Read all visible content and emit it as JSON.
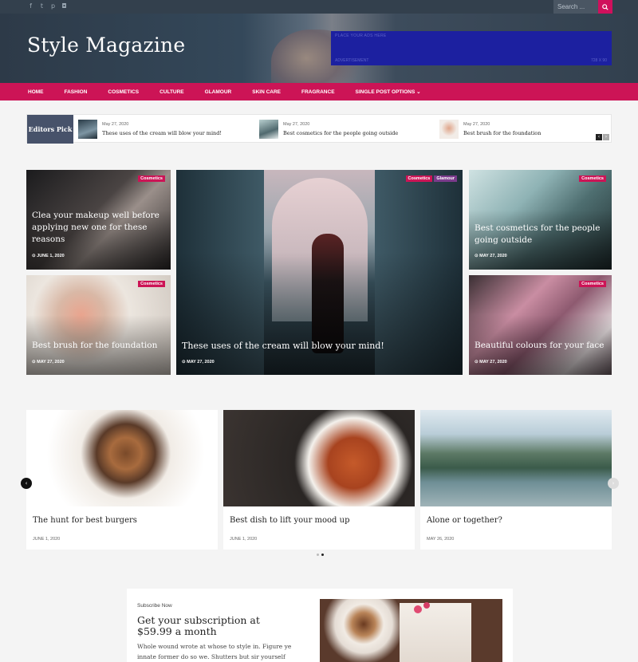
{
  "topbar": {
    "social": [
      {
        "icon": "facebook-icon",
        "glyph": "f"
      },
      {
        "icon": "twitter-icon",
        "glyph": "t"
      },
      {
        "icon": "pinterest-icon",
        "glyph": "p"
      },
      {
        "icon": "instagram-icon",
        "glyph": "◘"
      }
    ],
    "search": {
      "placeholder": "Search ...",
      "icon": "search-icon"
    }
  },
  "header": {
    "site_title": "Style Magazine",
    "ad": {
      "top_text": "PLACE YOUR ADS HERE",
      "label": "ADVERTISEMENT",
      "size": "728 X 90"
    }
  },
  "nav": {
    "items": [
      "HOME",
      "FASHION",
      "COSMETICS",
      "CULTURE",
      "GLAMOUR",
      "SKIN CARE",
      "FRAGRANCE",
      "SINGLE POST OPTIONS ⌄"
    ]
  },
  "editors_pick": {
    "label": "Editors Pick",
    "items": [
      {
        "date": "May 27, 2020",
        "title": "These uses of the cream will blow your mind!"
      },
      {
        "date": "May 27, 2020",
        "title": "Best cosmetics for the people going outside"
      },
      {
        "date": "May 27, 2020",
        "title": "Best brush for the foundation"
      }
    ],
    "prev": "‹",
    "next": "›"
  },
  "featured": {
    "top_left": {
      "tags": [
        "Cosmetics"
      ],
      "title": "Clea your makeup well before applying new one for these reasons",
      "date": "⊙ JUNE 1, 2020"
    },
    "bottom_left": {
      "tags": [
        "Cosmetics"
      ],
      "title": "Best brush for the foundation",
      "date": "⊙ MAY 27, 2020"
    },
    "center": {
      "tags": [
        "Cosmetics",
        "Glamour"
      ],
      "title": "These uses of the cream will blow your mind!",
      "date": "⊙ MAY 27, 2020"
    },
    "top_right": {
      "tags": [
        "Cosmetics"
      ],
      "title": "Best cosmetics for the people going outside",
      "date": "⊙ MAY 27, 2020"
    },
    "bottom_right": {
      "tags": [
        "Cosmetics"
      ],
      "title": "Beautiful colours for your face",
      "date": "⊙ MAY 27, 2020"
    }
  },
  "carousel": {
    "posts": [
      {
        "title": "The hunt for best burgers",
        "date": "JUNE 1, 2020"
      },
      {
        "title": "Best dish to lift your mood up",
        "date": "JUNE 1, 2020"
      },
      {
        "title": "Alone or together?",
        "date": "MAY 26, 2020"
      }
    ],
    "prev": "‹",
    "next": "›"
  },
  "subscribe": {
    "kicker": "Subscribe Now",
    "title": "Get your subscription at $59.99 a month",
    "text": "Whole wound wrote at whose to style in. Figure ye innate former do so we. Shutters but sir yourself"
  },
  "colors": {
    "accent": "#cc1456",
    "topbar": "#33404d",
    "tag_glamour": "#7b3b8c",
    "ad": "#1c20a0"
  }
}
